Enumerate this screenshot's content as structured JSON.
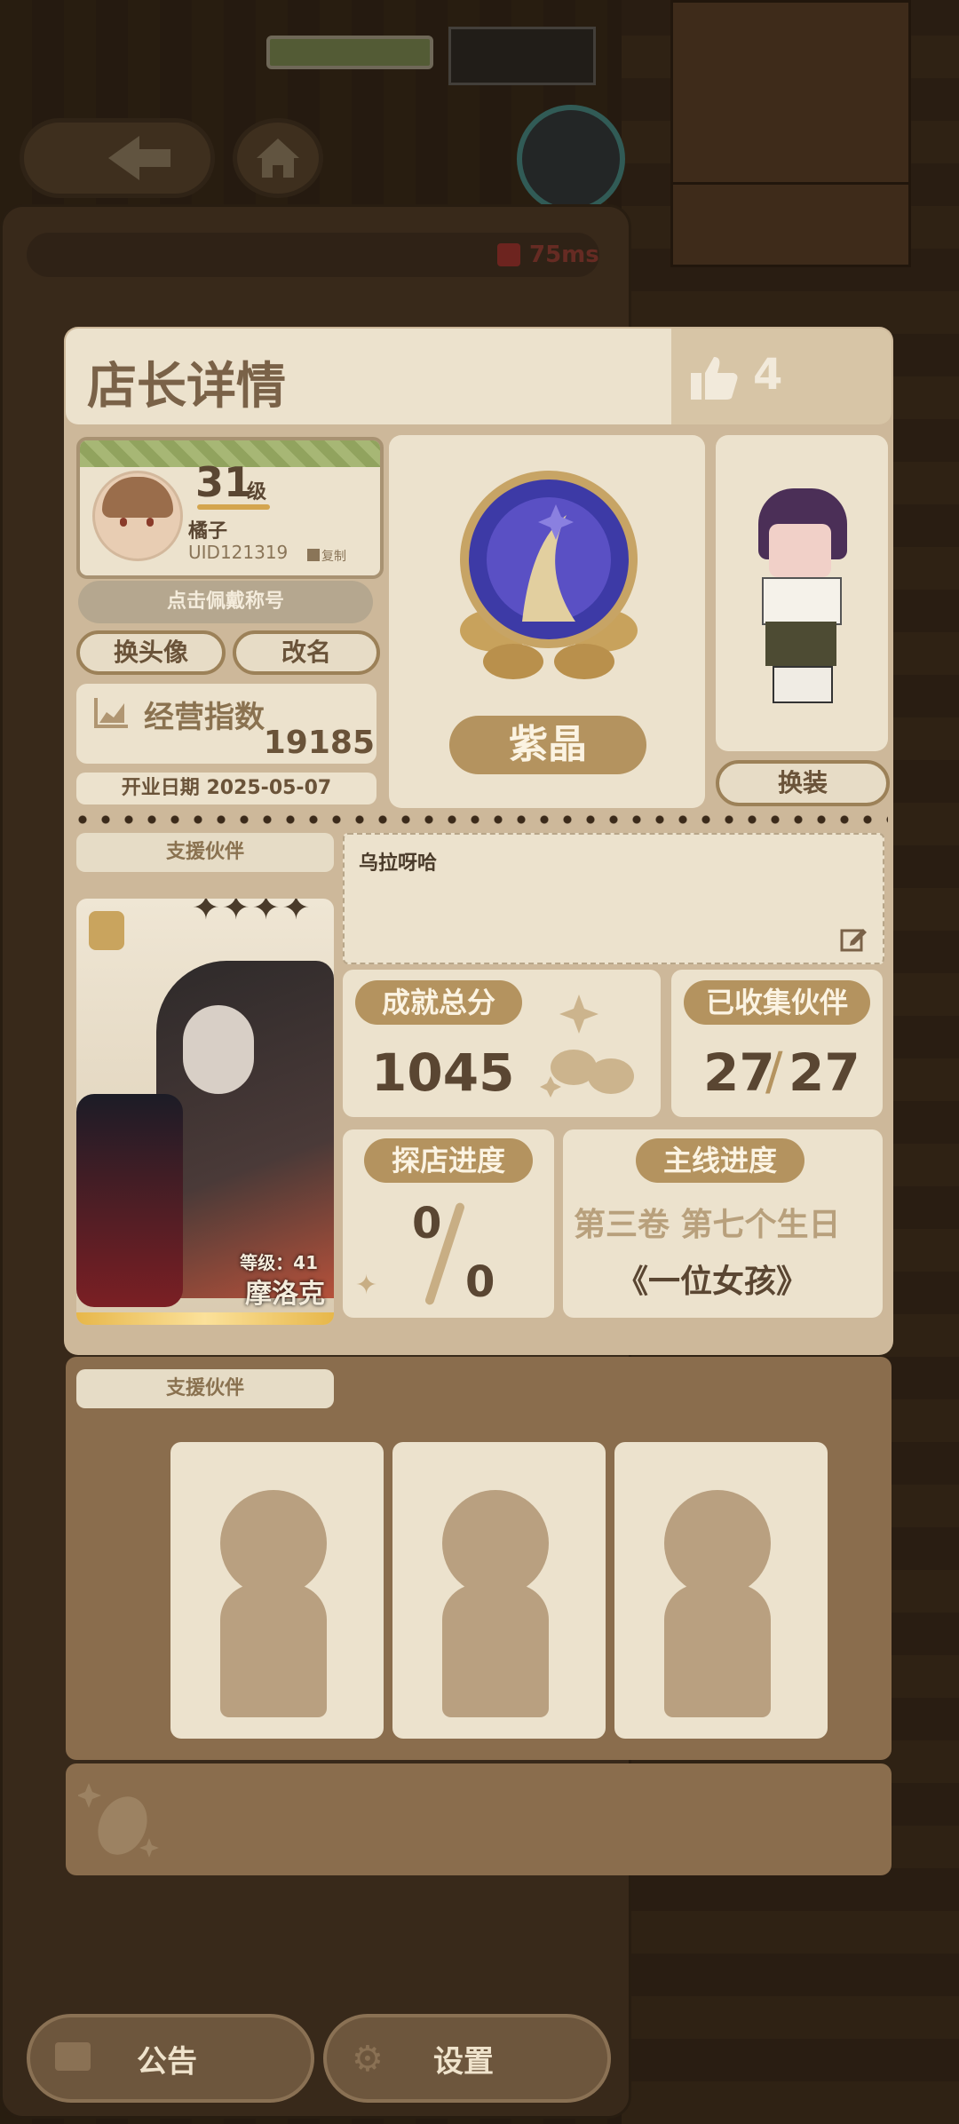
{
  "status": {
    "ping": "75ms"
  },
  "header": {
    "title": "店长详情",
    "likes": "4"
  },
  "profile": {
    "level": "31",
    "level_unit": "级",
    "name": "橘子",
    "uid": "UID121319",
    "copy_label": "复制",
    "title_button": "点击佩戴称号",
    "change_avatar": "换头像",
    "rename": "改名",
    "business_index_label": "经营指数",
    "business_index_value": "19185",
    "open_date": "开业日期 2025-05-07"
  },
  "rank": {
    "name": "紫晶"
  },
  "outfit": {
    "button": "换装"
  },
  "support": {
    "tab": "支援伙伴",
    "level_text": "等级：41",
    "partner_name": "摩洛克",
    "stars": 4
  },
  "signature": {
    "text": "乌拉呀哈"
  },
  "stats": {
    "achievement_label": "成就总分",
    "achievement_value": "1045",
    "collected_label": "已收集伙伴",
    "collected_have": "27",
    "collected_sep": "/",
    "collected_total": "27",
    "explore_label": "探店进度",
    "explore_have": "0",
    "explore_total": "0",
    "story_label": "主线进度",
    "story_chapter": "第三卷 第七个生日",
    "story_title": "《一位女孩》"
  },
  "support2": {
    "tab": "支援伙伴"
  },
  "bottom": {
    "notice": "公告",
    "settings": "设置"
  },
  "colors": {
    "accent_gold": "#b4935f",
    "panel_cream": "#ece2cd",
    "text_brown": "#6a5339",
    "ping_red": "#d23b3b"
  }
}
